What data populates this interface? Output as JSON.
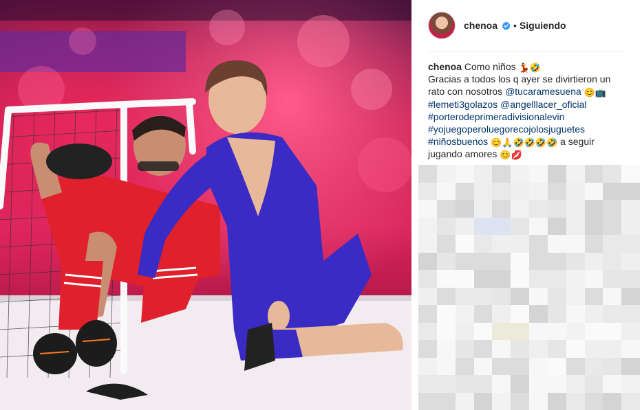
{
  "post": {
    "username": "chenoa",
    "separator": "•",
    "follow_status": "Siguiendo",
    "verified_icon": "verified-badge-icon"
  },
  "caption": {
    "author": "chenoa",
    "line1_text": "Como niños",
    "line1_emoji": "💃🤣",
    "line2_text": "Gracias a todos los q ayer se divirtieron un rato con nosotros",
    "mention_1": "@tucaramesuena",
    "mention_1_emoji": "😊📺",
    "hashtag_1": "#lemeti3golazos",
    "mention_2": "@angelllacer_oficial",
    "hashtag_2": "#porterodeprimeradivisionalevin",
    "hashtag_3": "#yojuegoperoluegorecojolosjuguetes",
    "hashtag_4": "#niñosbuenos",
    "hashtag_4_emoji": "😊🙏🤣🤣🤣🤣",
    "line_end_text": "a seguir jugando amores",
    "line_end_emoji": "😊💋"
  },
  "colors": {
    "accent_link": "#003569",
    "verified_blue": "#3897f0",
    "text_primary": "#262626",
    "dress_purple": "#3a2bc4",
    "jersey_red": "#e0202a"
  }
}
